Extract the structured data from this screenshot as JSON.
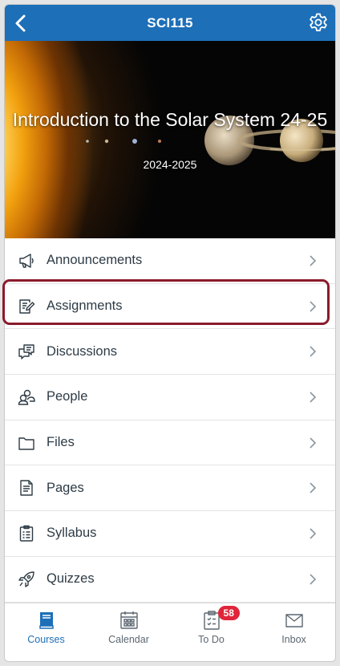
{
  "header": {
    "title": "SCI115",
    "back_icon": "chevron-left-icon",
    "settings_icon": "gear-icon",
    "color": "#1d6fb8"
  },
  "banner": {
    "course_name": "Introduction to the Solar System 24-25",
    "term": "2024-2025"
  },
  "menu": {
    "items": [
      {
        "label": "Announcements",
        "icon": "megaphone-icon"
      },
      {
        "label": "Assignments",
        "icon": "assignment-icon",
        "highlighted": true
      },
      {
        "label": "Discussions",
        "icon": "discussion-icon"
      },
      {
        "label": "People",
        "icon": "people-icon"
      },
      {
        "label": "Files",
        "icon": "folder-icon"
      },
      {
        "label": "Pages",
        "icon": "page-icon"
      },
      {
        "label": "Syllabus",
        "icon": "syllabus-icon"
      },
      {
        "label": "Quizzes",
        "icon": "rocket-icon"
      }
    ],
    "highlight_color": "#8a1b2b"
  },
  "tabbar": {
    "tabs": [
      {
        "label": "Courses",
        "icon": "courses-icon",
        "active": true
      },
      {
        "label": "Calendar",
        "icon": "calendar-icon"
      },
      {
        "label": "To Do",
        "icon": "todo-icon",
        "badge": "58"
      },
      {
        "label": "Inbox",
        "icon": "inbox-icon"
      }
    ],
    "active_color": "#1d6fb8",
    "badge_color": "#e0253a"
  }
}
